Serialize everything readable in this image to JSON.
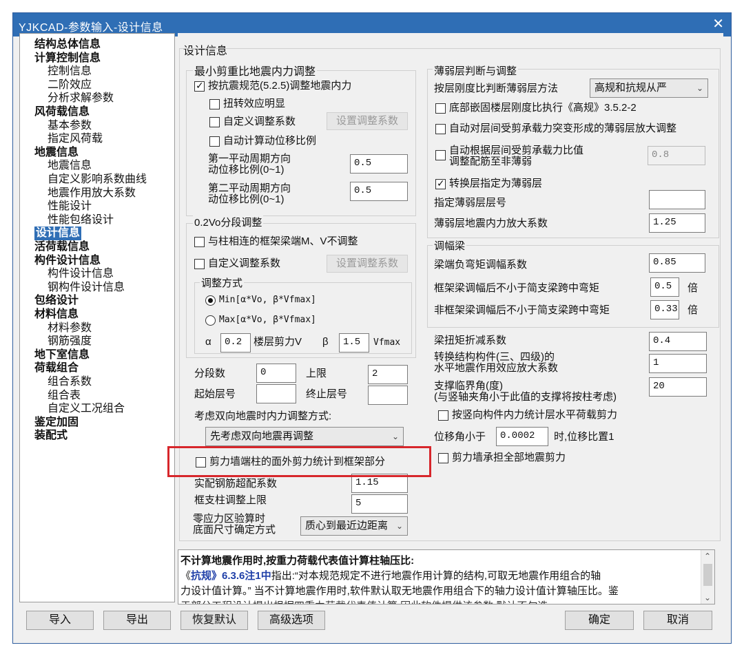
{
  "window": {
    "title": "YJKCAD-参数输入-设计信息",
    "close_label": "✕"
  },
  "tree": [
    {
      "label": "结构总体信息",
      "type": "cat"
    },
    {
      "label": "计算控制信息",
      "type": "cat"
    },
    {
      "label": "控制信息",
      "type": "sub"
    },
    {
      "label": "二阶效应",
      "type": "sub"
    },
    {
      "label": "分析求解参数",
      "type": "sub"
    },
    {
      "label": "风荷载信息",
      "type": "cat"
    },
    {
      "label": "基本参数",
      "type": "sub"
    },
    {
      "label": "指定风荷载",
      "type": "sub"
    },
    {
      "label": "地震信息",
      "type": "cat"
    },
    {
      "label": "地震信息",
      "type": "sub"
    },
    {
      "label": "自定义影响系数曲线",
      "type": "sub"
    },
    {
      "label": "地震作用放大系数",
      "type": "sub"
    },
    {
      "label": "性能设计",
      "type": "sub"
    },
    {
      "label": "性能包络设计",
      "type": "sub"
    },
    {
      "label": "设计信息",
      "type": "cat",
      "selected": true
    },
    {
      "label": "活荷载信息",
      "type": "cat"
    },
    {
      "label": "构件设计信息",
      "type": "cat"
    },
    {
      "label": "构件设计信息",
      "type": "sub"
    },
    {
      "label": "钢构件设计信息",
      "type": "sub"
    },
    {
      "label": "包络设计",
      "type": "cat"
    },
    {
      "label": "材料信息",
      "type": "cat"
    },
    {
      "label": "材料参数",
      "type": "sub"
    },
    {
      "label": "钢筋强度",
      "type": "sub"
    },
    {
      "label": "地下室信息",
      "type": "cat"
    },
    {
      "label": "荷载组合",
      "type": "cat"
    },
    {
      "label": "组合系数",
      "type": "sub"
    },
    {
      "label": "组合表",
      "type": "sub"
    },
    {
      "label": "自定义工况组合",
      "type": "sub"
    },
    {
      "label": "鉴定加固",
      "type": "cat"
    },
    {
      "label": "装配式",
      "type": "cat"
    }
  ],
  "left": {
    "section": "设计信息",
    "min_shear": {
      "title": "最小剪重比地震内力调整",
      "by_code": {
        "label": "按抗震规范(5.2.5)调整地震内力",
        "checked": true
      },
      "torsion": {
        "label": "扭转效应明显",
        "checked": false
      },
      "custom_coef": {
        "label": "自定义调整系数",
        "checked": false
      },
      "set_coef_btn": "设置调整系数",
      "auto_calc": {
        "label": "自动计算动位移比例",
        "checked": false
      },
      "period1_l1": "第一平动周期方向",
      "period1_l2": "动位移比例(0~1)",
      "period1_value": "0.5",
      "period2_l1": "第二平动周期方向",
      "period2_l2": "动位移比例(0~1)",
      "period2_value": "0.5"
    },
    "v02": {
      "title": "0.2Vo分段调整",
      "beam_end": {
        "label": "与柱相连的框架梁端M、V不调整",
        "checked": false
      },
      "custom_coef": {
        "label": "自定义调整系数",
        "checked": false
      },
      "set_coef_btn": "设置调整系数",
      "method_title": "调整方式",
      "min_label": "Min[α*Vo, β*Vfmax]",
      "max_label": "Max[α*Vo, β*Vfmax]",
      "min_on": true,
      "alpha_label": "α",
      "alpha_value": "0.2",
      "floor_shear_label": "楼层剪力V",
      "beta_label": "β",
      "beta_value": "1.5",
      "vfmax_label": "Vfmax",
      "segments_label": "分段数",
      "segments_value": "0",
      "upper_label": "上限",
      "upper_value": "2",
      "start_label": "起始层号",
      "start_value": "",
      "end_label": "终止层号",
      "end_value": ""
    },
    "bidir_label": "考虑双向地震时内力调整方式:",
    "bidir_value": "先考虑双向地震再调整",
    "wall_col": {
      "label": "剪力墙端柱的面外剪力统计到框架部分",
      "checked": false
    },
    "rebar_label": "实配钢筋超配系数",
    "rebar_value": "1.15",
    "frame_col_label": "框支柱调整上限",
    "frame_col_value": "5",
    "zero_l1": "零应力区验算时",
    "zero_l2": "底面尺寸确定方式",
    "zero_value": "质心到最近边距离"
  },
  "right": {
    "weak": {
      "title": "薄弱层判断与调整",
      "method_label": "按层刚度比判断薄弱层方法",
      "method_value": "高规和抗规从严",
      "bottom_fixed": {
        "label": "底部嵌固楼层刚度比执行《高规》3.5.2-2",
        "checked": false
      },
      "auto_amplify": {
        "label": "自动对层间受剪承载力突变形成的薄弱层放大调整",
        "checked": false
      },
      "auto_ratio_l1": "自动根据层间受剪承载力比值",
      "auto_ratio_l2": "调整配筋至非薄弱",
      "auto_ratio_checked": false,
      "auto_ratio_value": "0.8",
      "transfer": {
        "label": "转换层指定为薄弱层",
        "checked": true
      },
      "assign_label": "指定薄弱层层号",
      "assign_value": "",
      "amp_label": "薄弱层地震内力放大系数",
      "amp_value": "1.25"
    },
    "redist": {
      "title": "调幅梁",
      "neg_label": "梁端负弯矩调幅系数",
      "neg_value": "0.85",
      "frame_label": "框架梁调幅后不小于简支梁跨中弯矩",
      "frame_value": "0.5",
      "frame_unit": "倍",
      "nonframe_label": "非框架梁调幅后不小于简支梁跨中弯矩",
      "nonframe_value": "0.33",
      "nonframe_unit": "倍"
    },
    "torsion_label": "梁扭矩折减系数",
    "torsion_value": "0.4",
    "transfer_l1": "转换结构构件(三、四级)的",
    "transfer_l2": "水平地震作用效应放大系数",
    "transfer_value": "1",
    "brace_l1": "支撑临界角(度)",
    "brace_l2": "(与竖轴夹角小于此值的支撑将按柱考虑)",
    "brace_value": "20",
    "vert_member": {
      "label": "按竖向构件内力统计层水平荷载剪力",
      "checked": false
    },
    "drift_label": "位移角小于",
    "drift_value": "0.0002",
    "drift_suffix": "时,位移比置1",
    "wall_all": {
      "label": "剪力墙承担全部地震剪力",
      "checked": false
    }
  },
  "info": {
    "line1": "不计算地震作用时,按重力荷载代表值计算柱轴压比:",
    "line2_prefix": "《",
    "line2_ref": "抗规》6.3.6注1中",
    "line2_rest": "指出:“对本规范规定不进行地震作用计算的结构,可取无地震作用组合的轴",
    "line3": "力设计值计算。” 当不计算地震作用时,软件默认取无地震作用组合下的轴力设计值计算轴压比。鉴",
    "line4": "于部分工程设计提出根据四重力荷载代表值计算,因此软件提供该参数,默认不勾选。"
  },
  "buttons": {
    "import": "导入",
    "export": "导出",
    "restore": "恢复默认",
    "advanced": "高级选项",
    "ok": "确定",
    "cancel": "取消"
  },
  "colors": {
    "titlebar": "#2f6eb5",
    "highlight": "#d7262b",
    "selection": "#2f6eb5"
  }
}
